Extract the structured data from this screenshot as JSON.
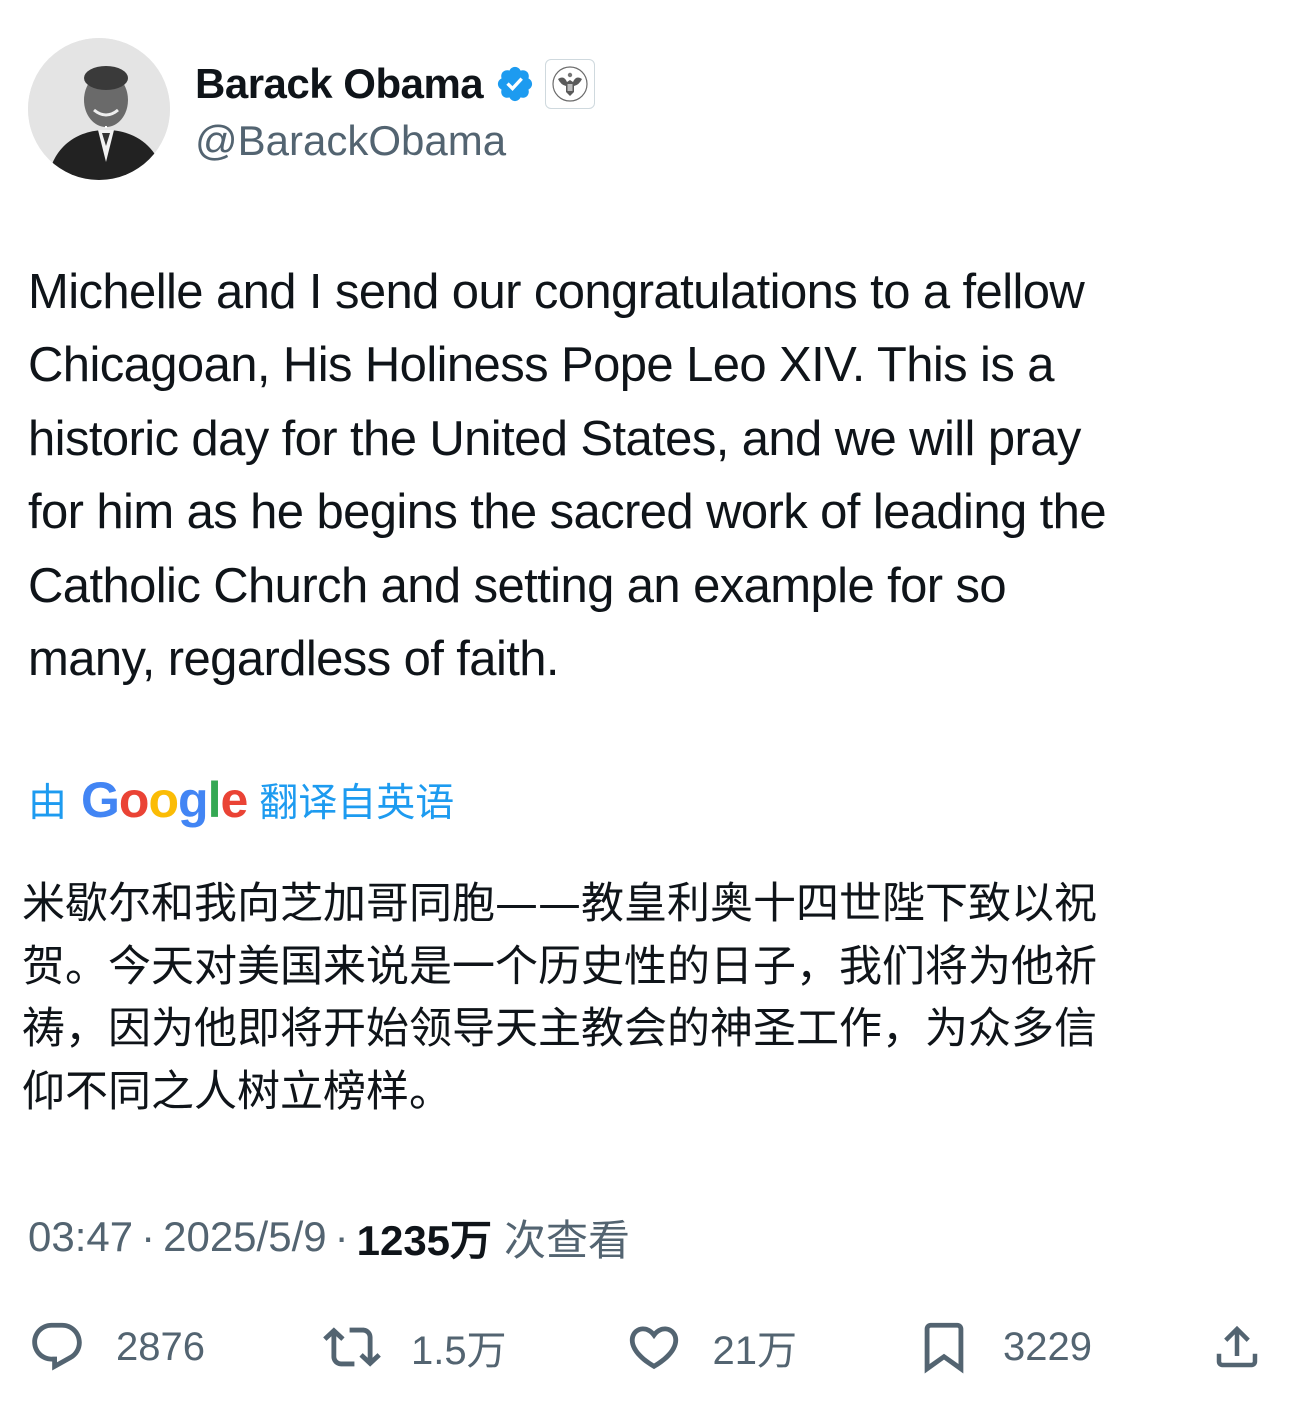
{
  "author": {
    "display_name": "Barack Obama",
    "handle": "@BarackObama",
    "verified_icon": "verified-badge-icon",
    "affiliation_icon": "us-government-seal-icon"
  },
  "tweet": {
    "text": "Michelle and I send our congratulations to a fellow\nChicagoan, His Holiness Pope Leo XIV. This is a\nhistoric day for the United States, and we will pray\nfor him as he begins the sacred work of leading the\nCatholic Church and setting an example for so\nmany, regardless of faith."
  },
  "translation": {
    "prefix": "由",
    "provider": "Google",
    "suffix": "翻译自英语",
    "text": "米歇尔和我向芝加哥同胞——教皇利奥十四世陛下致以祝\n贺。今天对美国来说是一个历史性的日子，我们将为他祈\n祷，因为他即将开始领导天主教会的神圣工作，为众多信\n仰不同之人树立榜样。"
  },
  "meta": {
    "time": "03:47",
    "dot1": "·",
    "date": "2025/5/9",
    "dot2": "·",
    "views_count": "1235万",
    "views_label": "次查看"
  },
  "actions": {
    "replies": "2876",
    "retweets": "1.5万",
    "likes": "21万",
    "bookmarks": "3229"
  },
  "colors": {
    "accent": "#1d9bf0",
    "secondary_text": "#536471",
    "primary_text": "#0f1419",
    "google_blue": "#4285F4",
    "google_red": "#EA4335",
    "google_yellow": "#FBBC05",
    "google_green": "#34A853"
  }
}
